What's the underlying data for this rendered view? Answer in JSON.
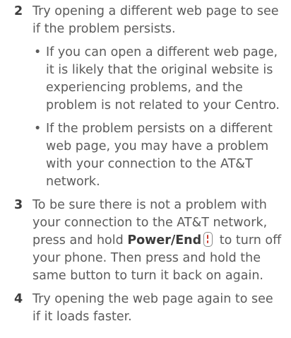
{
  "steps": [
    {
      "number": "2",
      "text": "Try opening a different web page to see if the problem persists.",
      "bullets": [
        "If you can open a different web page, it is likely that the original website is experiencing problems, and the problem is not related to your Centro.",
        "If the problem persists on a different web page, you may have a problem with your connection to the AT&T network."
      ]
    },
    {
      "number": "3",
      "text_before": "To be sure there is not a problem with your connection to the AT&T network, press and hold ",
      "bold": "Power/End",
      "text_after": " to turn off your phone. Then press and hold the same button to turn it back on again.",
      "icon": "power-end-key-icon"
    },
    {
      "number": "4",
      "text": "Try opening the web page again to see if it loads faster."
    }
  ],
  "colors": {
    "text": "#5b5b5b",
    "number": "#3c3c3c",
    "icon_accent": "#c93a2d"
  }
}
